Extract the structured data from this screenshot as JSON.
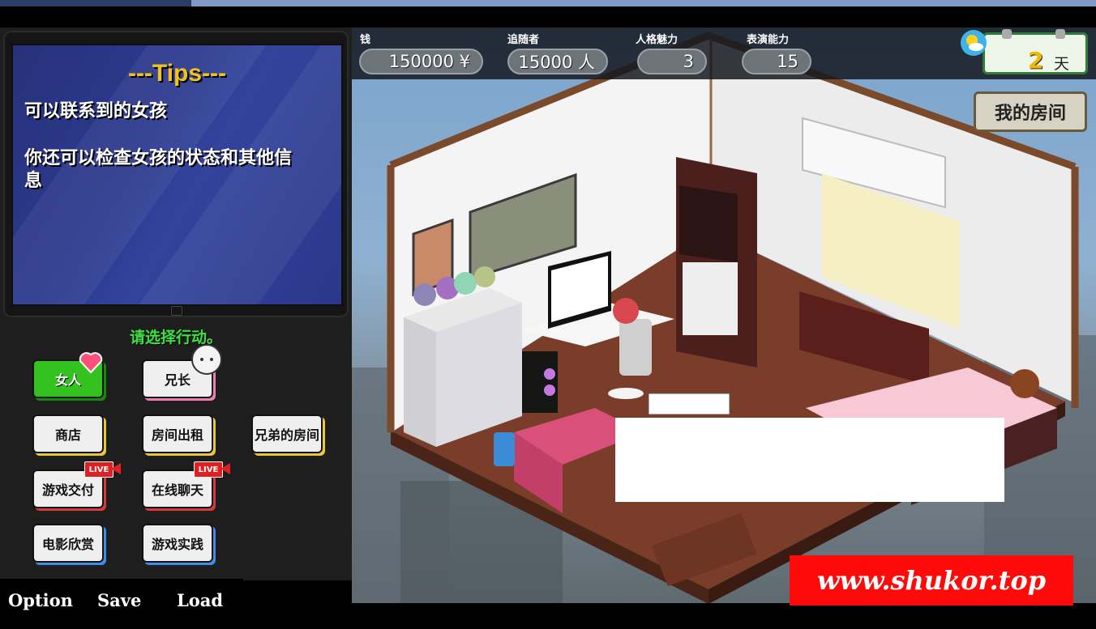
{
  "stats": {
    "money": {
      "label": "钱",
      "value": "150000 ¥"
    },
    "followers": {
      "label": "追随者",
      "value": "15000 人"
    },
    "charm": {
      "label": "人格魅力",
      "value": "3"
    },
    "acting": {
      "label": "表演能力",
      "value": "15"
    }
  },
  "day": {
    "number": "2",
    "unit": "天",
    "weather_icon": "sun-cloud-icon"
  },
  "location_button": "我的房间",
  "tips": {
    "title": "---Tips---",
    "line1": "可以联系到的女孩",
    "line2a": "你还可以检查女孩的状态和其他信",
    "line2b": "息"
  },
  "prompt": "请选择行动。",
  "actions": {
    "woman": "女人",
    "brother": "兄长",
    "shop": "商店",
    "rent_room": "房间出租",
    "brother_room": "兄弟的房间",
    "game_delivery": "游戏交付",
    "online_chat": "在线聊天",
    "movie": "电影欣赏",
    "game_practice": "游戏实践",
    "live_badge": "LIVE"
  },
  "system": {
    "option": "Option",
    "save": "Save",
    "load": "Load"
  },
  "watermark": "www.shukor.top",
  "colors": {
    "accent_green": "#33c21f",
    "tips_yellow": "#f2c21c",
    "prompt_green": "#3ee043",
    "watermark_red": "#ff0a0a"
  }
}
